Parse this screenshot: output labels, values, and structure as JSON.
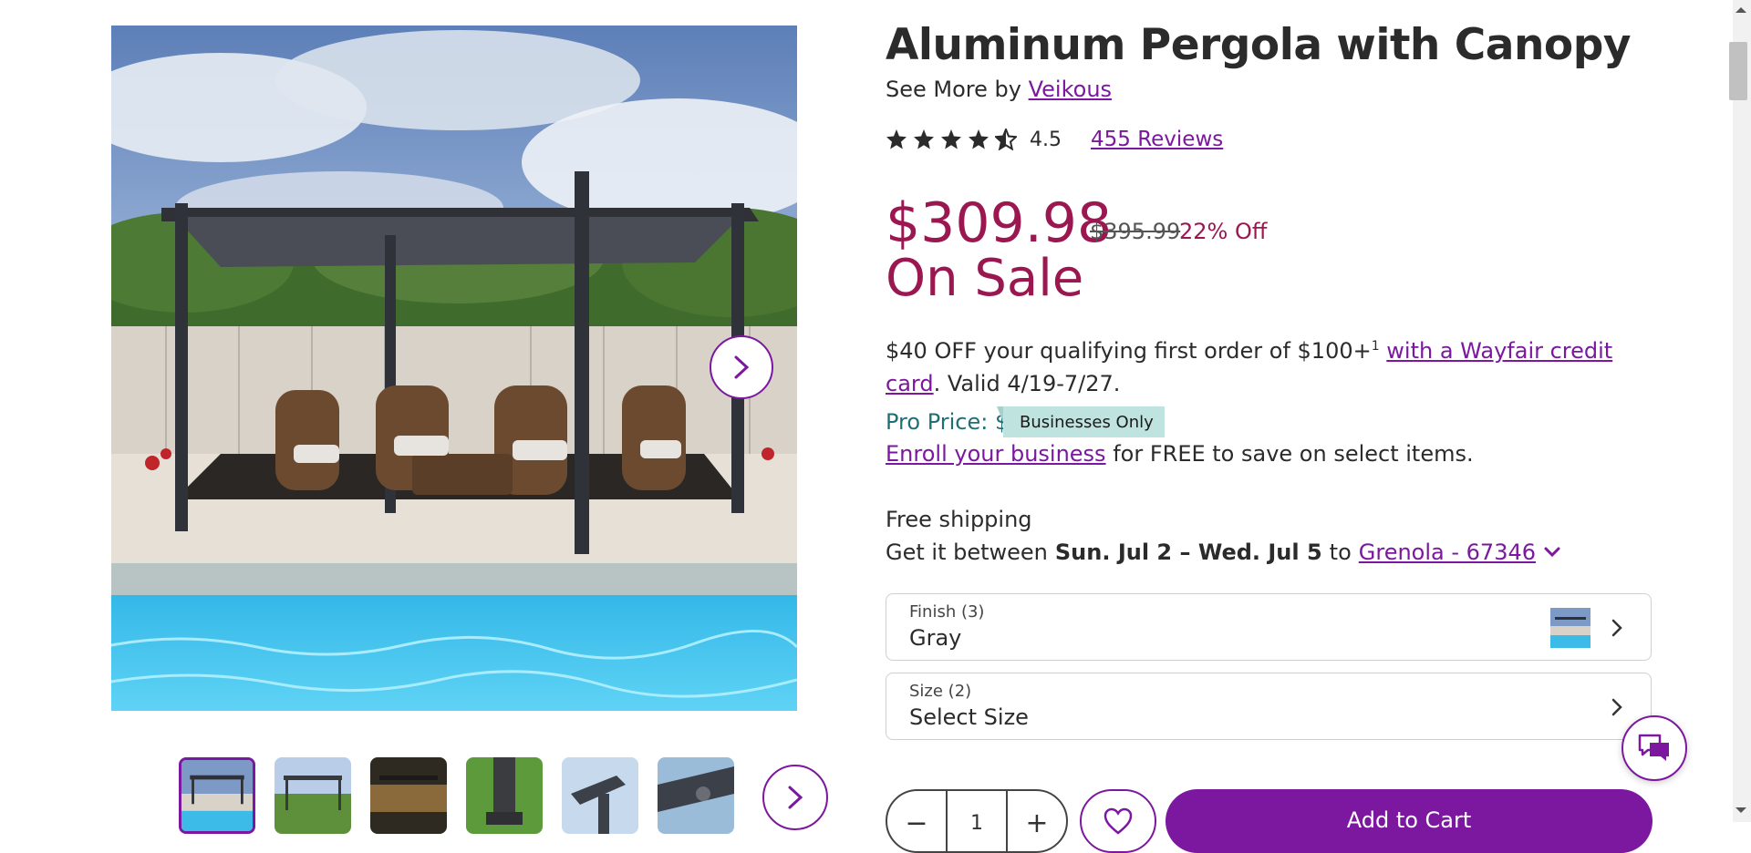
{
  "product": {
    "title": "Aluminum Pergola with Canopy",
    "see_more_prefix": "See More by",
    "brand": "Veikous",
    "rating_value": "4.5",
    "rating_stars": 4.5,
    "reviews_label": "455 Reviews"
  },
  "pricing": {
    "sale_price": "$309.98",
    "was_price": "$395.99",
    "discount": "22% Off",
    "on_sale_label": "On Sale"
  },
  "promo": {
    "text_before": "$40 OFF your qualifying first order of $100+",
    "footnote": "1",
    "link": "with a Wayfair credit card",
    "text_after": ". Valid 4/19-7/27."
  },
  "pro": {
    "label": "Pro Price: $",
    "badge": "Businesses Only",
    "enroll_link": "Enroll your business",
    "enroll_text": "for FREE to save on select items."
  },
  "shipping": {
    "free": "Free shipping",
    "get_it_prefix": "Get it between",
    "dates": "Sun. Jul 2 – Wed. Jul 5",
    "to": "to",
    "location": "Grenola - 67346"
  },
  "options": {
    "finish_label": "Finish (3)",
    "finish_value": "Gray",
    "size_label": "Size (2)",
    "size_value": "Select Size"
  },
  "cart": {
    "quantity": "1",
    "minus": "−",
    "plus": "+",
    "add_label": "Add to Cart"
  },
  "colors": {
    "accent": "#7b189f",
    "sale": "#9a1750",
    "pro": "#1f6f74",
    "badge_bg": "#bfe3df"
  },
  "icons": {
    "next": "chevron-right-icon",
    "heart": "heart-icon",
    "chat": "chat-icon",
    "location_toggle": "chevron-down-icon"
  }
}
